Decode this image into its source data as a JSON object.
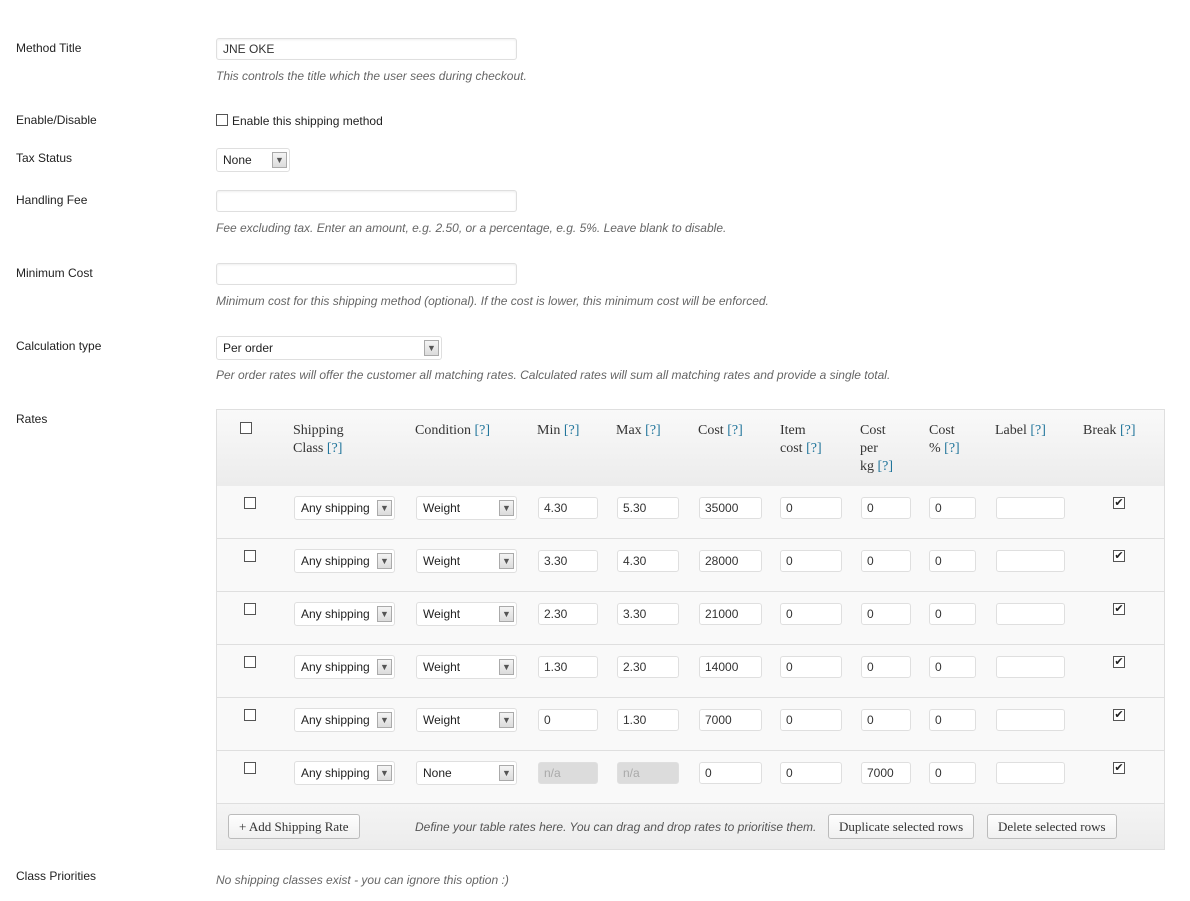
{
  "method_title": {
    "label": "Method Title",
    "value": "JNE OKE",
    "description": "This controls the title which the user sees during checkout."
  },
  "enable": {
    "label": "Enable/Disable",
    "checkbox_label": "Enable this shipping method",
    "checked": false
  },
  "tax_status": {
    "label": "Tax Status",
    "value": "None"
  },
  "handling_fee": {
    "label": "Handling Fee",
    "value": "",
    "description": "Fee excluding tax. Enter an amount, e.g. 2.50, or a percentage, e.g. 5%. Leave blank to disable."
  },
  "minimum_cost": {
    "label": "Minimum Cost",
    "value": "",
    "description": "Minimum cost for this shipping method (optional). If the cost is lower, this minimum cost will be enforced."
  },
  "calculation_type": {
    "label": "Calculation type",
    "value": "Per order",
    "description": "Per order rates will offer the customer all matching rates. Calculated rates will sum all matching rates and provide a single total."
  },
  "rates": {
    "label": "Rates",
    "help": "[?]",
    "headers": {
      "shipping_class_1": "Shipping",
      "shipping_class_2": "Class",
      "condition": "Condition",
      "min": "Min",
      "max": "Max",
      "cost": "Cost",
      "item_cost_1": "Item",
      "item_cost_2": "cost",
      "cost_per_kg_1": "Cost",
      "cost_per_kg_2": "per",
      "cost_per_kg_3": "kg",
      "cost_pct_1": "Cost",
      "cost_pct_2": "%",
      "label": "Label",
      "break": "Break"
    },
    "rows": [
      {
        "shipping_class": "Any shipping",
        "condition": "Weight",
        "min": "4.30",
        "max": "5.30",
        "cost": "35000",
        "item_cost": "0",
        "cost_per_kg": "0",
        "cost_pct": "0",
        "label": "",
        "break": true
      },
      {
        "shipping_class": "Any shipping",
        "condition": "Weight",
        "min": "3.30",
        "max": "4.30",
        "cost": "28000",
        "item_cost": "0",
        "cost_per_kg": "0",
        "cost_pct": "0",
        "label": "",
        "break": true
      },
      {
        "shipping_class": "Any shipping",
        "condition": "Weight",
        "min": "2.30",
        "max": "3.30",
        "cost": "21000",
        "item_cost": "0",
        "cost_per_kg": "0",
        "cost_pct": "0",
        "label": "",
        "break": true
      },
      {
        "shipping_class": "Any shipping",
        "condition": "Weight",
        "min": "1.30",
        "max": "2.30",
        "cost": "14000",
        "item_cost": "0",
        "cost_per_kg": "0",
        "cost_pct": "0",
        "label": "",
        "break": true
      },
      {
        "shipping_class": "Any shipping",
        "condition": "Weight",
        "min": "0",
        "max": "1.30",
        "cost": "7000",
        "item_cost": "0",
        "cost_per_kg": "0",
        "cost_pct": "0",
        "label": "",
        "break": true
      },
      {
        "shipping_class": "Any shipping",
        "condition": "None",
        "min": "n/a",
        "max": "n/a",
        "cost": "0",
        "item_cost": "0",
        "cost_per_kg": "7000",
        "cost_pct": "0",
        "label": "",
        "break": true,
        "min_max_disabled": true
      }
    ],
    "footer": {
      "add_button": "+ Add Shipping Rate",
      "hint": "Define your table rates here. You can drag and drop rates to prioritise them.",
      "duplicate_button": "Duplicate selected rows",
      "delete_button": "Delete selected rows"
    }
  },
  "class_priorities": {
    "label": "Class Priorities",
    "description": "No shipping classes exist - you can ignore this option :)"
  },
  "colors": {
    "help_link": "#21759b",
    "border": "#dfdfdf"
  }
}
